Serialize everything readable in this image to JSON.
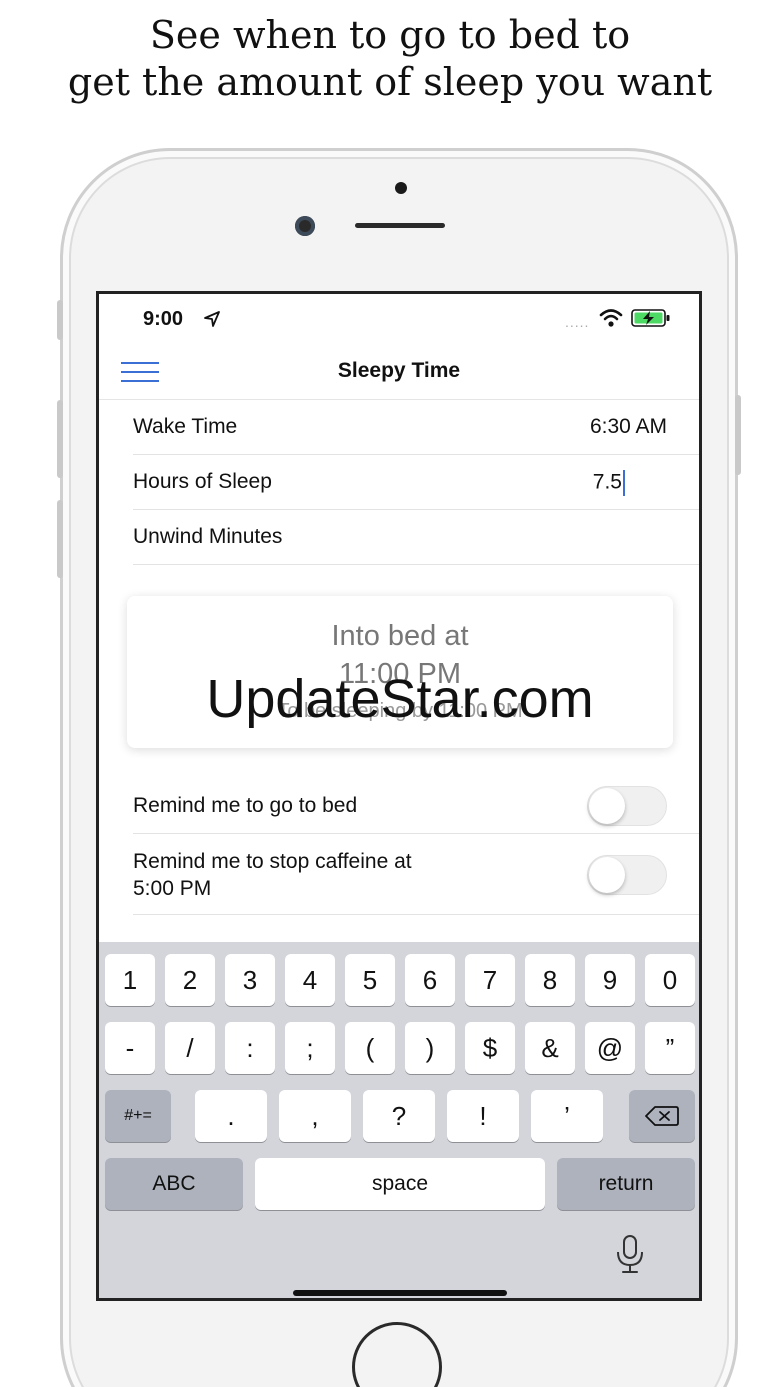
{
  "headline": {
    "line1": "See when to go to bed to",
    "line2": "get the amount of sleep you want"
  },
  "status": {
    "time": "9:00",
    "signal": "....."
  },
  "nav": {
    "title": "Sleepy Time"
  },
  "form": {
    "wake_time": {
      "label": "Wake Time",
      "value": "6:30 AM"
    },
    "hours_of_sleep": {
      "label": "Hours of Sleep",
      "value": "7.5"
    },
    "unwind_minutes": {
      "label": "Unwind Minutes",
      "value": ""
    }
  },
  "result": {
    "line1": "Into bed at",
    "line2": "11:00 PM",
    "line3": "To be sleeping by 11:00 PM"
  },
  "watermark": "UpdateStar.com",
  "reminders": {
    "bed": {
      "label": "Remind me to go to bed",
      "enabled": false
    },
    "caffeine": {
      "label_line1": "Remind me to stop caffeine at",
      "label_line2": "5:00 PM",
      "enabled": false
    }
  },
  "keyboard": {
    "row1": [
      "1",
      "2",
      "3",
      "4",
      "5",
      "6",
      "7",
      "8",
      "9",
      "0"
    ],
    "row2": [
      "-",
      "/",
      ":",
      ";",
      "(",
      ")",
      "$",
      "&",
      "@",
      "”"
    ],
    "row3": {
      "shift": "#+=",
      "keys": [
        ".",
        ",",
        "?",
        "!",
        "’"
      ]
    },
    "row4": {
      "abc": "ABC",
      "space": "space",
      "return": "return"
    }
  },
  "colors": {
    "accent": "#3b6fd6",
    "battery": "#4cd964",
    "keyboard_bg": "#d3d5db"
  }
}
